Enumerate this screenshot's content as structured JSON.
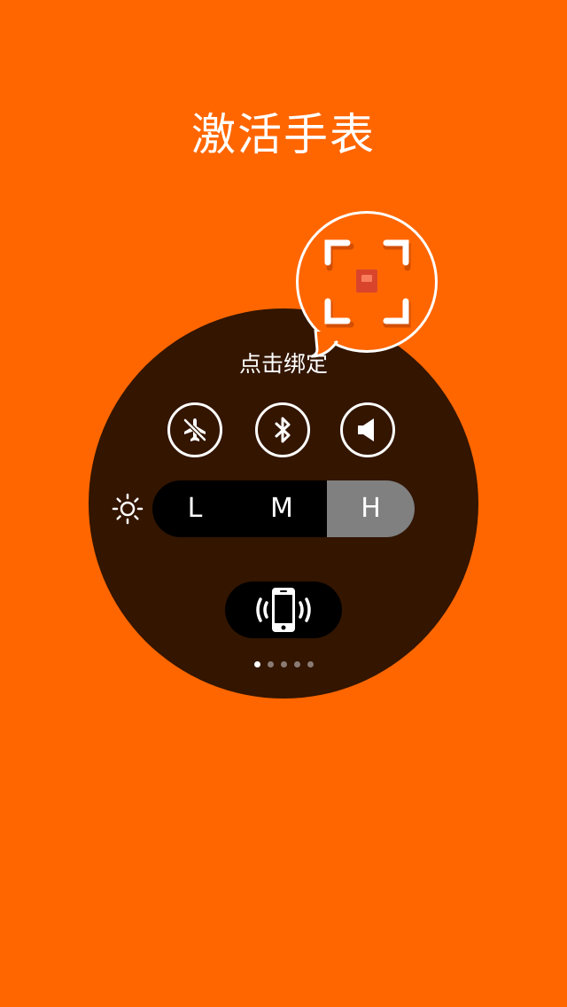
{
  "header": {
    "title": "激活手表"
  },
  "bind_prompt": {
    "label": "点击绑定",
    "icon": "scan-qr-icon"
  },
  "quick_toggles": [
    {
      "name": "airplane-mode",
      "icon": "airplane-off-icon"
    },
    {
      "name": "bluetooth",
      "icon": "bluetooth-icon"
    },
    {
      "name": "sound",
      "icon": "speaker-icon"
    }
  ],
  "brightness": {
    "icon": "sun-icon",
    "options": [
      "L",
      "M",
      "H"
    ],
    "selected": "H"
  },
  "find_phone": {
    "icon": "phone-vibrate-icon"
  },
  "pager": {
    "count": 5,
    "active_index": 0
  },
  "colors": {
    "background": "#FF6600",
    "watch_face": "#331500",
    "selected_level": "#808080"
  }
}
